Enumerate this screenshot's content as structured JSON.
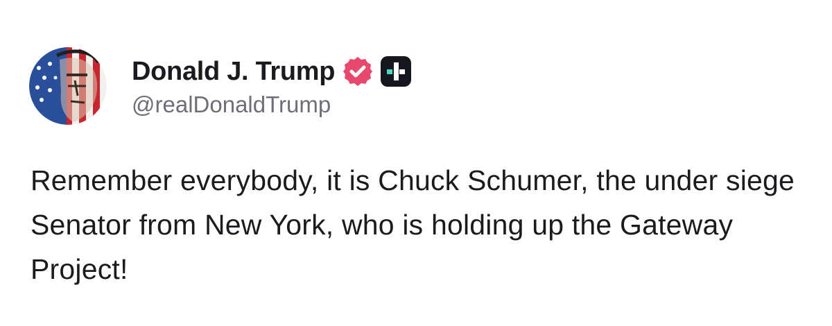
{
  "post": {
    "author": {
      "display_name": "Donald J. Trump",
      "handle": "@realDonaldTrump",
      "avatar_icon": "flag-portrait-avatar",
      "verified_icon": "verified-badge-icon",
      "verified_color": "#e8486e",
      "platform_badge_icon": "truth-social-plus-icon"
    },
    "text": "Remember everybody, it is Chuck Schumer, the under siege Senator from New York, who is holding up the Gateway Project!"
  }
}
